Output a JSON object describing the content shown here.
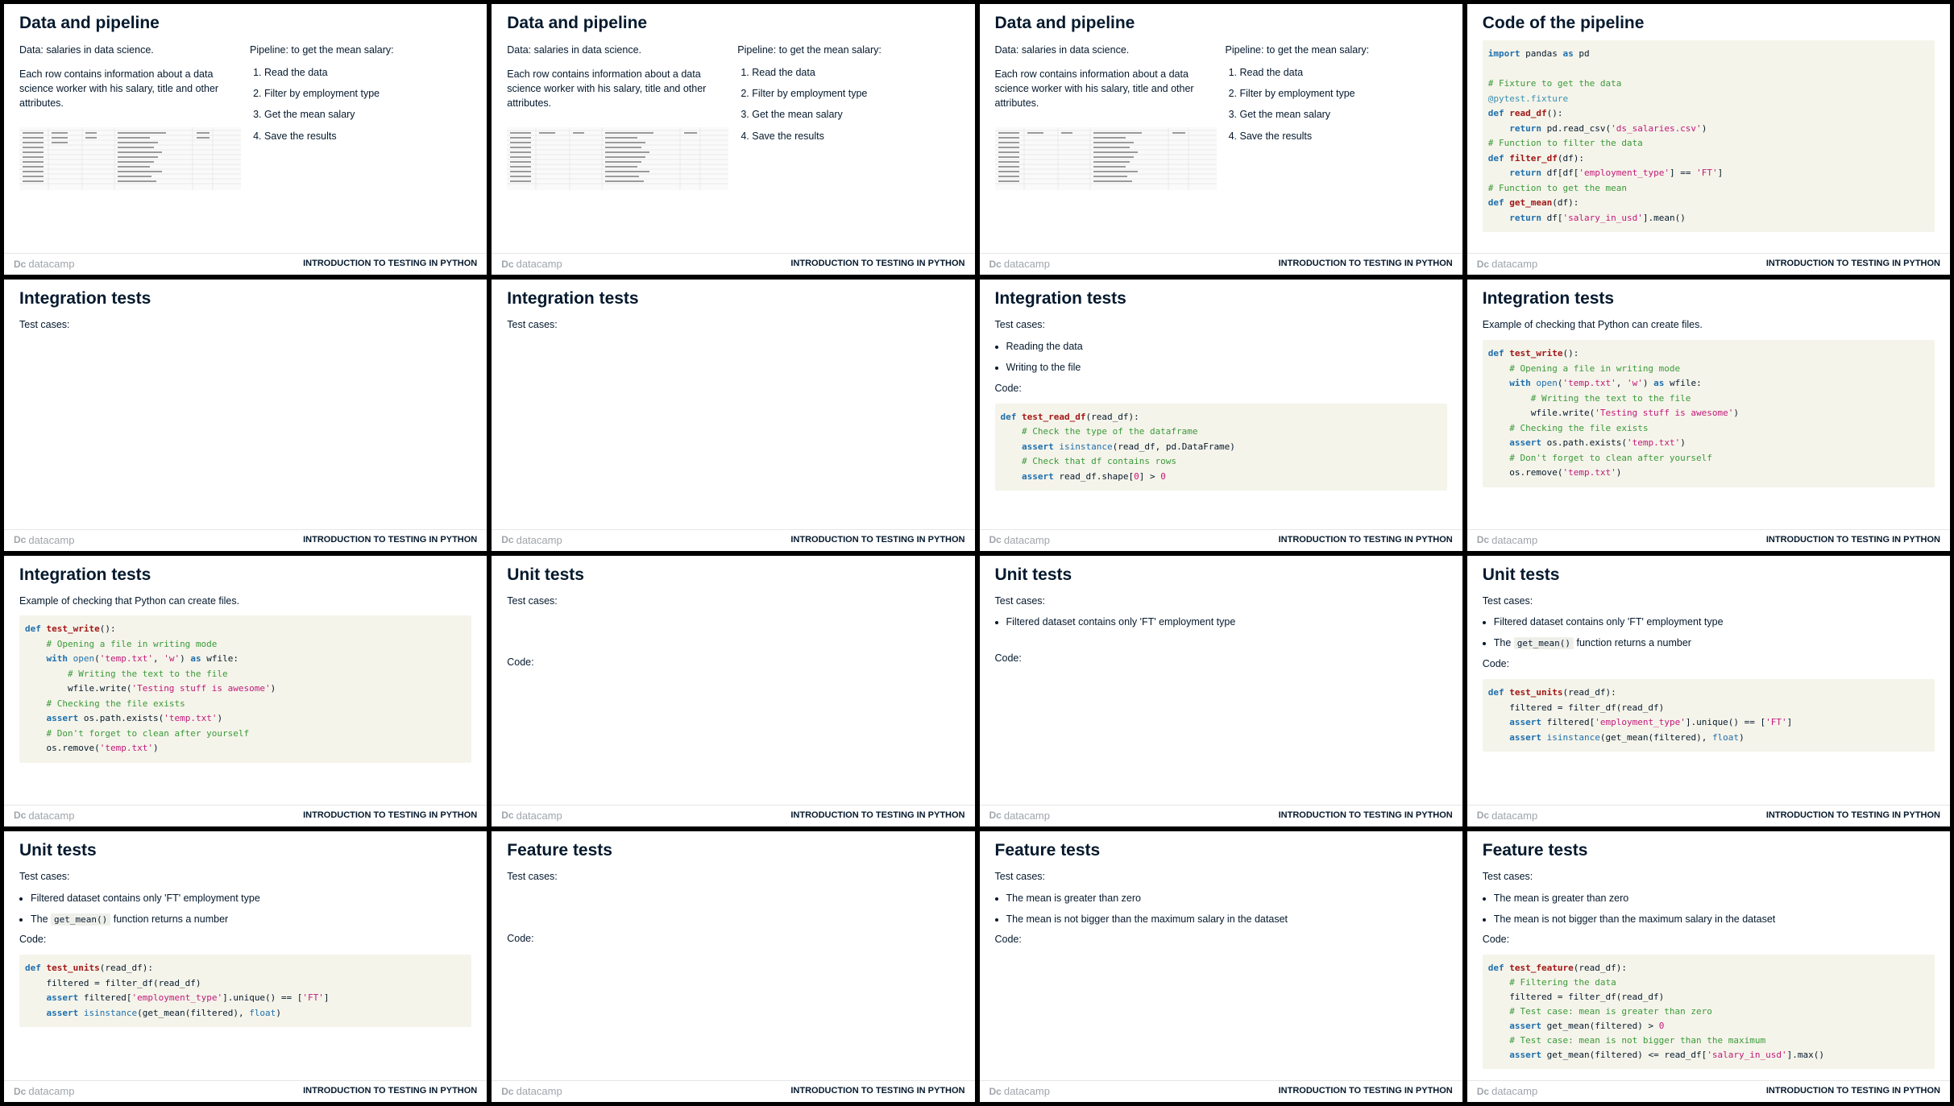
{
  "footer": {
    "brand": "datacamp",
    "course": "INTRODUCTION TO TESTING IN PYTHON"
  },
  "data_slide": {
    "title": "Data and pipeline",
    "data_line": "Data: salaries in data science.",
    "description": "Each row contains information about a data science worker with his salary, title and other attributes.",
    "pipeline_heading": "Pipeline: to get the mean salary:",
    "steps": [
      "Read the data",
      "Filter by employment type",
      "Get the mean salary",
      "Save the results"
    ]
  },
  "code_slide": {
    "title": "Code of the pipeline"
  },
  "integration": {
    "title": "Integration tests",
    "test_cases": "Test cases:",
    "code_label": "Code:",
    "items": [
      "Reading the data",
      "Writing to the file"
    ],
    "example": "Example of checking that Python can create files."
  },
  "unit": {
    "title": "Unit tests",
    "test_cases": "Test cases:",
    "code_label": "Code:",
    "item1": "Filtered dataset contains only 'FT' employment type",
    "item2_pre": "The",
    "item2_code": "get_mean()",
    "item2_post": "function returns a number"
  },
  "feature": {
    "title": "Feature tests",
    "test_cases": "Test cases:",
    "code_label": "Code:",
    "items": [
      "The mean is greater than zero",
      "The mean is not bigger than the maximum salary in the dataset"
    ]
  }
}
